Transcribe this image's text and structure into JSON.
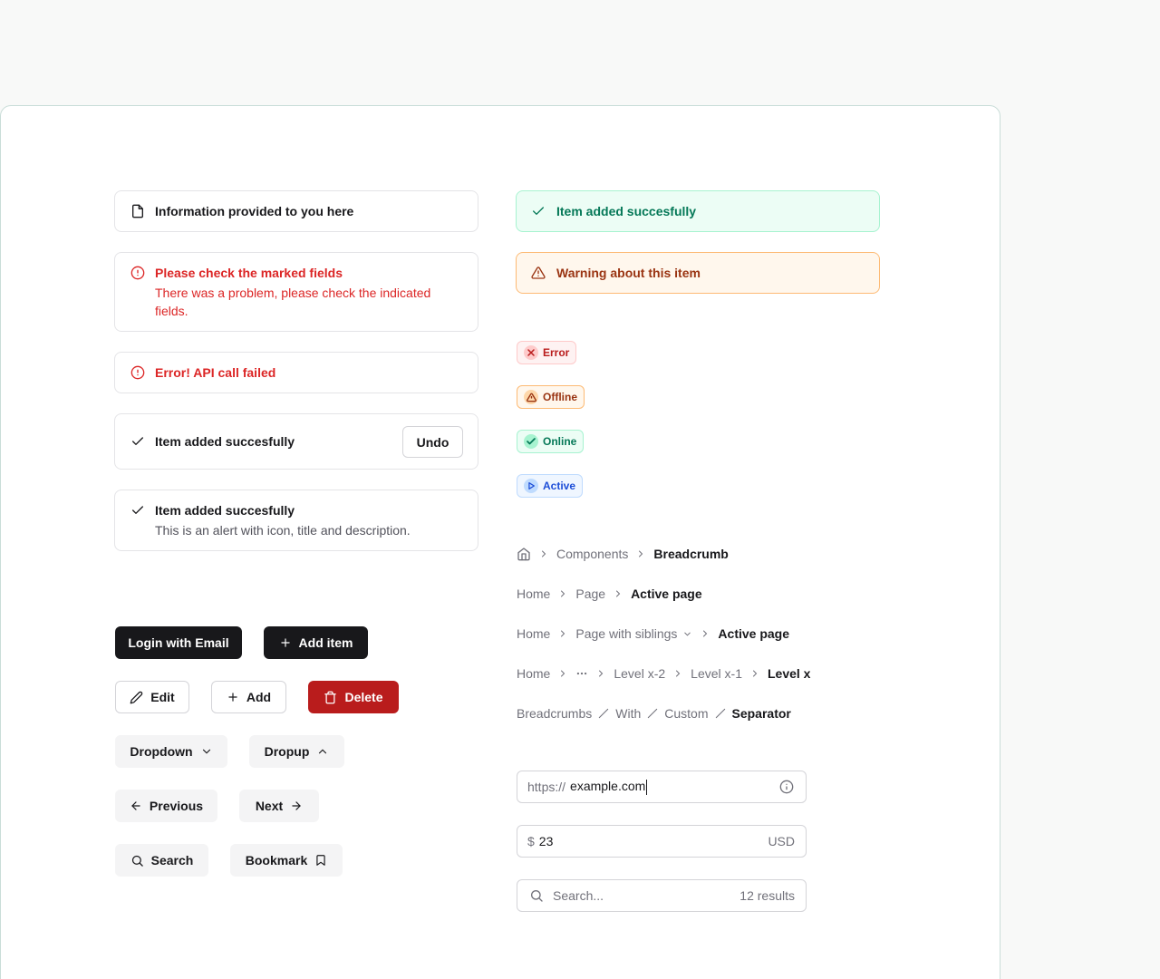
{
  "alerts_left": {
    "info": {
      "title": "Information provided to you here",
      "icon": "file-icon"
    },
    "error_form": {
      "title": "Please check the marked fields",
      "description": "There was a problem, please check the indicated fields.",
      "icon": "alert-circle-icon"
    },
    "error_api": {
      "title": "Error! API call failed",
      "icon": "alert-circle-icon"
    },
    "success_undo": {
      "title": "Item added succesfully",
      "action_label": "Undo",
      "icon": "check-icon"
    },
    "success_desc": {
      "title": "Item added succesfully",
      "description": "This is an alert with icon, title and description.",
      "icon": "check-icon"
    }
  },
  "alerts_right": {
    "success": {
      "title": "Item added succesfully",
      "color": "#047857",
      "bg": "#ecfdf5"
    },
    "warning": {
      "title": "Warning about this item",
      "color": "#9a3412",
      "bg": "#fff7ed"
    }
  },
  "badges": [
    {
      "label": "Error",
      "icon": "x-icon",
      "color": "#b91c1c"
    },
    {
      "label": "Offline",
      "icon": "warning-triangle-icon",
      "color": "#9a3412"
    },
    {
      "label": "Online",
      "icon": "check-icon",
      "color": "#047857"
    },
    {
      "label": "Active",
      "icon": "play-icon",
      "color": "#1d4ed8"
    }
  ],
  "buttons": {
    "login": "Login with Email",
    "add_item": "Add item",
    "edit": "Edit",
    "add": "Add",
    "delete": "Delete",
    "dropdown": "Dropdown",
    "dropup": "Dropup",
    "previous": "Previous",
    "next": "Next",
    "search": "Search",
    "bookmark": "Bookmark"
  },
  "breadcrumbs": {
    "b1": {
      "items": [
        "Components"
      ],
      "current": "Breadcrumb"
    },
    "b2": {
      "items": [
        "Home",
        "Page"
      ],
      "current": "Active page"
    },
    "b3": {
      "items": [
        "Home",
        "Page with siblings"
      ],
      "current": "Active page"
    },
    "b4": {
      "items": [
        "Home",
        "Level x-2",
        "Level x-1"
      ],
      "current": "Level x"
    },
    "b5": {
      "items": [
        "Breadcrumbs",
        "With",
        "Custom"
      ],
      "current": "Separator"
    }
  },
  "inputs": {
    "url": {
      "prefix": "https://",
      "value": "example.com"
    },
    "price": {
      "prefix": "$",
      "value": "23",
      "suffix": "USD"
    },
    "search": {
      "placeholder": "Search...",
      "count": "12 results"
    }
  }
}
